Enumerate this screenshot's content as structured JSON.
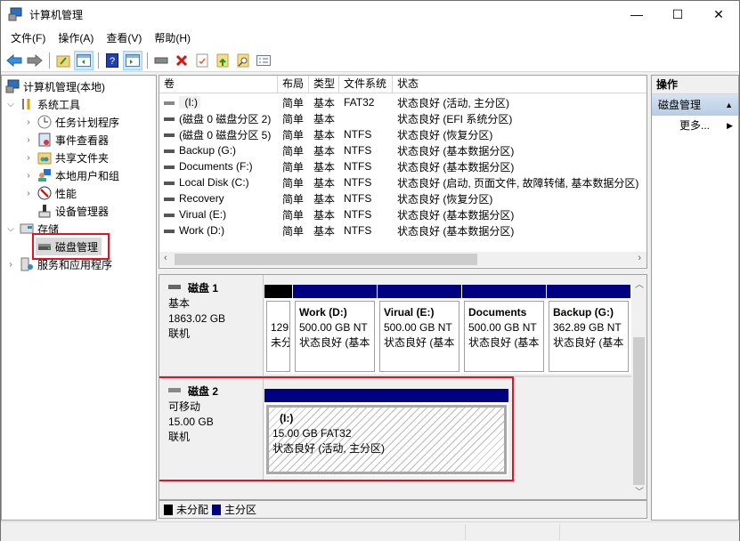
{
  "window": {
    "title": "计算机管理",
    "controls": {
      "minimize": "—",
      "maximize": "☐",
      "close": "✕"
    }
  },
  "menu": [
    "文件(F)",
    "操作(A)",
    "查看(V)",
    "帮助(H)"
  ],
  "toolbar": {
    "icons": [
      "back-icon",
      "forward-icon",
      "up-folder-icon",
      "show-hide-tree-icon",
      "help-icon",
      "show-hide-action-pane-icon",
      "connect-drive-icon",
      "delete-icon",
      "properties-icon",
      "import-icon",
      "search-icon",
      "checklist-icon"
    ]
  },
  "tree": {
    "root": "计算机管理(本地)",
    "system_tools": "系统工具",
    "system_children": [
      "任务计划程序",
      "事件查看器",
      "共享文件夹",
      "本地用户和组",
      "性能",
      "设备管理器"
    ],
    "storage": "存储",
    "disk_mgmt": "磁盘管理",
    "services": "服务和应用程序"
  },
  "volumes": {
    "headers": [
      "卷",
      "布局",
      "类型",
      "文件系统",
      "状态"
    ],
    "rows": [
      {
        "vol": " (I:)",
        "layout": "简单",
        "type": "基本",
        "fs": "FAT32",
        "status": "状态良好 (活动, 主分区)"
      },
      {
        "vol": "(磁盘 0 磁盘分区 2)",
        "layout": "简单",
        "type": "基本",
        "fs": "",
        "status": "状态良好 (EFI 系统分区)"
      },
      {
        "vol": "(磁盘 0 磁盘分区 5)",
        "layout": "简单",
        "type": "基本",
        "fs": "NTFS",
        "status": "状态良好 (恢复分区)"
      },
      {
        "vol": "Backup (G:)",
        "layout": "简单",
        "type": "基本",
        "fs": "NTFS",
        "status": "状态良好 (基本数据分区)"
      },
      {
        "vol": "Documents (F:)",
        "layout": "简单",
        "type": "基本",
        "fs": "NTFS",
        "status": "状态良好 (基本数据分区)"
      },
      {
        "vol": "Local Disk (C:)",
        "layout": "简单",
        "type": "基本",
        "fs": "NTFS",
        "status": "状态良好 (启动, 页面文件, 故障转储, 基本数据分区)"
      },
      {
        "vol": "Recovery",
        "layout": "简单",
        "type": "基本",
        "fs": "NTFS",
        "status": "状态良好 (恢复分区)"
      },
      {
        "vol": "Virual (E:)",
        "layout": "简单",
        "type": "基本",
        "fs": "NTFS",
        "status": "状态良好 (基本数据分区)"
      },
      {
        "vol": "Work (D:)",
        "layout": "简单",
        "type": "基本",
        "fs": "NTFS",
        "status": "状态良好 (基本数据分区)"
      }
    ]
  },
  "disks": [
    {
      "name": "磁盘 1",
      "kind": "基本",
      "size": "1863.02 GB",
      "state": "联机",
      "partitions": [
        {
          "title": "",
          "line1": "129",
          "line2": "未分",
          "color": "#000000"
        },
        {
          "title": "Work  (D:)",
          "line1": "500.00 GB NT",
          "line2": "状态良好 (基本",
          "color": "#000080"
        },
        {
          "title": "Virual  (E:)",
          "line1": "500.00 GB NT",
          "line2": "状态良好 (基本",
          "color": "#000080"
        },
        {
          "title": "Documents",
          "line1": "500.00 GB NT",
          "line2": "状态良好 (基本",
          "color": "#000080"
        },
        {
          "title": "Backup  (G:)",
          "line1": "362.89 GB NT",
          "line2": "状态良好 (基本",
          "color": "#000080"
        }
      ]
    },
    {
      "name": "磁盘 2",
      "kind": "可移动",
      "size": "15.00 GB",
      "state": "联机",
      "partitions": [
        {
          "title": " (I:)",
          "line1": "15.00 GB FAT32",
          "line2": "状态良好 (活动, 主分区)",
          "color": "#000080"
        }
      ]
    }
  ],
  "legend": [
    {
      "label": "未分配",
      "color": "#000000"
    },
    {
      "label": "主分区",
      "color": "#000080"
    }
  ],
  "actions": {
    "header": "操作",
    "section": "磁盘管理",
    "more": "更多..."
  },
  "colors": {
    "highlight": "#e81123",
    "primary_partition": "#000080",
    "unallocated": "#000000"
  }
}
